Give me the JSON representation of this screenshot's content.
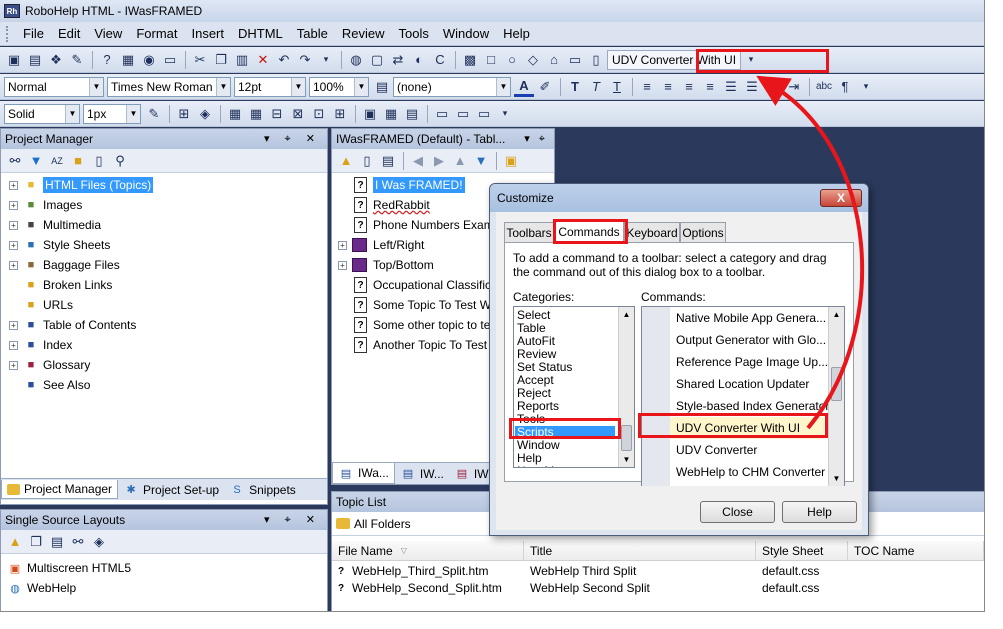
{
  "window": {
    "title": "RoboHelp HTML - IWasFRAMED",
    "app_icon": "Rh"
  },
  "menu": [
    "File",
    "Edit",
    "View",
    "Format",
    "Insert",
    "DHTML",
    "Table",
    "Review",
    "Tools",
    "Window",
    "Help"
  ],
  "toolbar": {
    "udv_button_label": "UDV Converter With UI",
    "style_value": "Normal",
    "font_value": "Times New Roman",
    "size_value": "12pt",
    "zoom_value": "100%",
    "css_value": "(none)",
    "border_style_value": "Solid",
    "border_width_value": "1px"
  },
  "project_manager": {
    "title": "Project Manager",
    "items": [
      {
        "label": "HTML Files (Topics)",
        "expandable": true,
        "selected": true,
        "icon": "folder-topics-icon"
      },
      {
        "label": "Images",
        "expandable": true,
        "icon": "images-icon"
      },
      {
        "label": "Multimedia",
        "expandable": true,
        "icon": "multimedia-icon"
      },
      {
        "label": "Style Sheets",
        "expandable": true,
        "icon": "stylesheet-icon"
      },
      {
        "label": "Baggage Files",
        "expandable": true,
        "icon": "baggage-icon"
      },
      {
        "label": "Broken Links",
        "expandable": false,
        "icon": "broken-link-icon"
      },
      {
        "label": "URLs",
        "expandable": false,
        "icon": "url-icon"
      },
      {
        "label": "Table of Contents",
        "expandable": true,
        "icon": "toc-icon"
      },
      {
        "label": "Index",
        "expandable": true,
        "icon": "index-icon"
      },
      {
        "label": "Glossary",
        "expandable": true,
        "icon": "glossary-icon"
      },
      {
        "label": "See Also",
        "expandable": false,
        "icon": "see-also-icon"
      }
    ],
    "tabs": [
      "Project Manager",
      "Project Set-up",
      "Snippets"
    ]
  },
  "toc_pane": {
    "title": "IWasFRAMED (Default) - Tabl...",
    "items": [
      {
        "label": "I Was FRAMED!",
        "type": "topic",
        "selected": true
      },
      {
        "label": "RedRabbit",
        "type": "topic"
      },
      {
        "label": "Phone Numbers Exampl",
        "type": "topic"
      },
      {
        "label": "Left/Right",
        "type": "book"
      },
      {
        "label": "Top/Bottom",
        "type": "book"
      },
      {
        "label": "Occupational Classificati",
        "type": "topic"
      },
      {
        "label": "Some Topic To Test Wi",
        "type": "topic"
      },
      {
        "label": "Some other topic to test",
        "type": "topic"
      },
      {
        "label": "Another Topic To Test W",
        "type": "topic"
      }
    ],
    "tabs": [
      "IWa...",
      "IW...",
      "IW..."
    ]
  },
  "single_source": {
    "title": "Single Source Layouts",
    "items": [
      "Multiscreen HTML5",
      "WebHelp"
    ]
  },
  "topic_list": {
    "title": "Topic List",
    "folder": "All Folders",
    "columns": [
      "File Name",
      "Title",
      "Style Sheet",
      "TOC Name"
    ],
    "rows": [
      [
        "WebHelp_Third_Split.htm",
        "WebHelp Third Split",
        "default.css",
        ""
      ],
      [
        "WebHelp_Second_Split.htm",
        "WebHelp Second Split",
        "default.css",
        ""
      ]
    ]
  },
  "dialog": {
    "title": "Customize",
    "close_glyph": "X",
    "tabs": [
      "Toolbars",
      "Commands",
      "Keyboard",
      "Options"
    ],
    "instructions": "To add a command to a toolbar: select a category and drag the command out of this dialog box to a toolbar.",
    "categories_label": "Categories:",
    "commands_label": "Commands:",
    "categories": [
      "Select",
      "Table",
      "AutoFit",
      "Review",
      "Set Status",
      "Accept",
      "Reject",
      "Reports",
      "Tools",
      "Scripts",
      "Window",
      "Help",
      "New Menu"
    ],
    "commands": [
      "Native Mobile App Genera...",
      "Output Generator with Glo...",
      "Reference Page Image Up...",
      "Shared Location Updater",
      "Style-based Index Generator",
      "UDV Converter With UI",
      "UDV Converter",
      "WebHelp to CHM Converter"
    ],
    "close_button": "Close",
    "help_button": "Help"
  },
  "colors": {
    "highlight": "#e8161b",
    "selection": "#3399ff",
    "workspace": "#2b3a5c"
  }
}
